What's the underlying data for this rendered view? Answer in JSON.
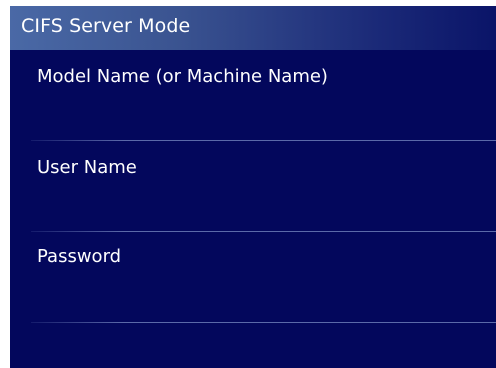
{
  "header": {
    "title": "CIFS Server Mode"
  },
  "fields": [
    {
      "label": "Model Name (or Machine Name)",
      "value": ""
    },
    {
      "label": "User Name",
      "value": ""
    },
    {
      "label": "Password",
      "value": ""
    }
  ],
  "colors": {
    "background": "#03075c",
    "header_start": "#4a69a6",
    "header_end": "#0a1468",
    "text": "#ffffff",
    "divider": "#96aadc"
  }
}
